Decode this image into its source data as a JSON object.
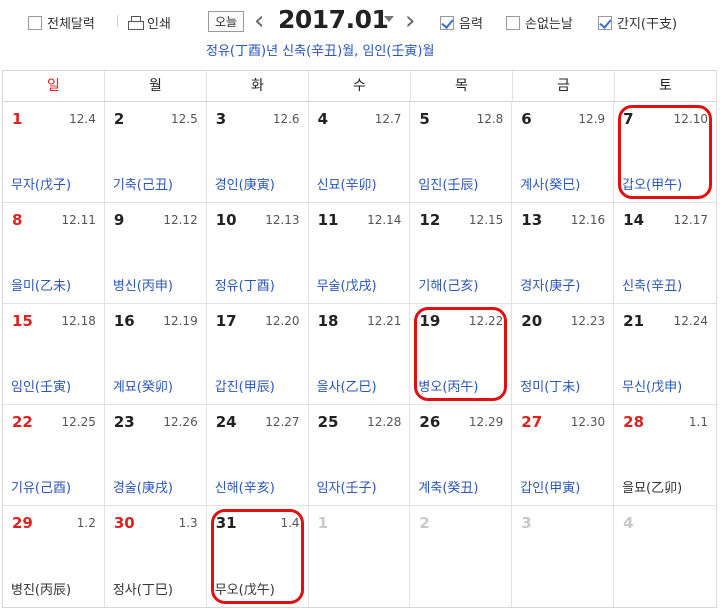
{
  "toolbar": {
    "full_month_label": "전체달력",
    "print_label": "인쇄",
    "today_label": "오늘",
    "title": "2017.01",
    "lunar_label": "음력",
    "lunar_checked": true,
    "nobad_label": "손없는날",
    "nobad_checked": false,
    "ganzhi_label": "간지(干支)",
    "ganzhi_checked": true,
    "ganzhi_line": "정유(丁酉)년 신축(辛丑)월, 임인(壬寅)월"
  },
  "weekdays": [
    "일",
    "월",
    "화",
    "수",
    "목",
    "금",
    "토"
  ],
  "cells": [
    {
      "day": "1",
      "lunar": "12.4",
      "ganzhi": "무자(戊子)",
      "sunday": true
    },
    {
      "day": "2",
      "lunar": "12.5",
      "ganzhi": "기축(己丑)"
    },
    {
      "day": "3",
      "lunar": "12.6",
      "ganzhi": "경인(庚寅)"
    },
    {
      "day": "4",
      "lunar": "12.7",
      "ganzhi": "신묘(辛卯)"
    },
    {
      "day": "5",
      "lunar": "12.8",
      "ganzhi": "임진(壬辰)"
    },
    {
      "day": "6",
      "lunar": "12.9",
      "ganzhi": "계사(癸巳)"
    },
    {
      "day": "7",
      "lunar": "12.10",
      "ganzhi": "갑오(甲午)",
      "highlight": true
    },
    {
      "day": "8",
      "lunar": "12.11",
      "ganzhi": "을미(乙未)",
      "sunday": true
    },
    {
      "day": "9",
      "lunar": "12.12",
      "ganzhi": "병신(丙申)"
    },
    {
      "day": "10",
      "lunar": "12.13",
      "ganzhi": "정유(丁酉)"
    },
    {
      "day": "11",
      "lunar": "12.14",
      "ganzhi": "무술(戊戌)"
    },
    {
      "day": "12",
      "lunar": "12.15",
      "ganzhi": "기해(己亥)"
    },
    {
      "day": "13",
      "lunar": "12.16",
      "ganzhi": "경자(庚子)"
    },
    {
      "day": "14",
      "lunar": "12.17",
      "ganzhi": "신축(辛丑)"
    },
    {
      "day": "15",
      "lunar": "12.18",
      "ganzhi": "임인(壬寅)",
      "sunday": true
    },
    {
      "day": "16",
      "lunar": "12.19",
      "ganzhi": "계묘(癸卯)"
    },
    {
      "day": "17",
      "lunar": "12.20",
      "ganzhi": "갑진(甲辰)"
    },
    {
      "day": "18",
      "lunar": "12.21",
      "ganzhi": "을사(乙巳)"
    },
    {
      "day": "19",
      "lunar": "12.22",
      "ganzhi": "병오(丙午)",
      "highlight": true
    },
    {
      "day": "20",
      "lunar": "12.23",
      "ganzhi": "정미(丁未)"
    },
    {
      "day": "21",
      "lunar": "12.24",
      "ganzhi": "무신(戊申)"
    },
    {
      "day": "22",
      "lunar": "12.25",
      "ganzhi": "기유(己酉)",
      "sunday": true
    },
    {
      "day": "23",
      "lunar": "12.26",
      "ganzhi": "경술(庚戌)"
    },
    {
      "day": "24",
      "lunar": "12.27",
      "ganzhi": "신해(辛亥)"
    },
    {
      "day": "25",
      "lunar": "12.28",
      "ganzhi": "임자(壬子)"
    },
    {
      "day": "26",
      "lunar": "12.29",
      "ganzhi": "계축(癸丑)"
    },
    {
      "day": "27",
      "lunar": "12.30",
      "ganzhi": "갑인(甲寅)",
      "red_day": true
    },
    {
      "day": "28",
      "lunar": "1.1",
      "ganzhi": "을묘(乙卯)",
      "red_day": true,
      "dark_ganzhi": true
    },
    {
      "day": "29",
      "lunar": "1.2",
      "ganzhi": "병진(丙辰)",
      "sunday": true,
      "dark_ganzhi": true
    },
    {
      "day": "30",
      "lunar": "1.3",
      "ganzhi": "정사(丁巳)",
      "red_day": true,
      "dark_ganzhi": true
    },
    {
      "day": "31",
      "lunar": "1.4",
      "ganzhi": "무오(戊午)",
      "highlight": true,
      "dark_ganzhi": true
    },
    {
      "day": "1",
      "lunar": "",
      "ganzhi": "",
      "other": true
    },
    {
      "day": "2",
      "lunar": "",
      "ganzhi": "",
      "other": true
    },
    {
      "day": "3",
      "lunar": "",
      "ganzhi": "",
      "other": true
    },
    {
      "day": "4",
      "lunar": "",
      "ganzhi": "",
      "other": true
    }
  ],
  "colors": {
    "sunday_red": "#dd2222",
    "ganzhi_blue": "#2a56b8",
    "highlight_circle": "#e01010"
  }
}
